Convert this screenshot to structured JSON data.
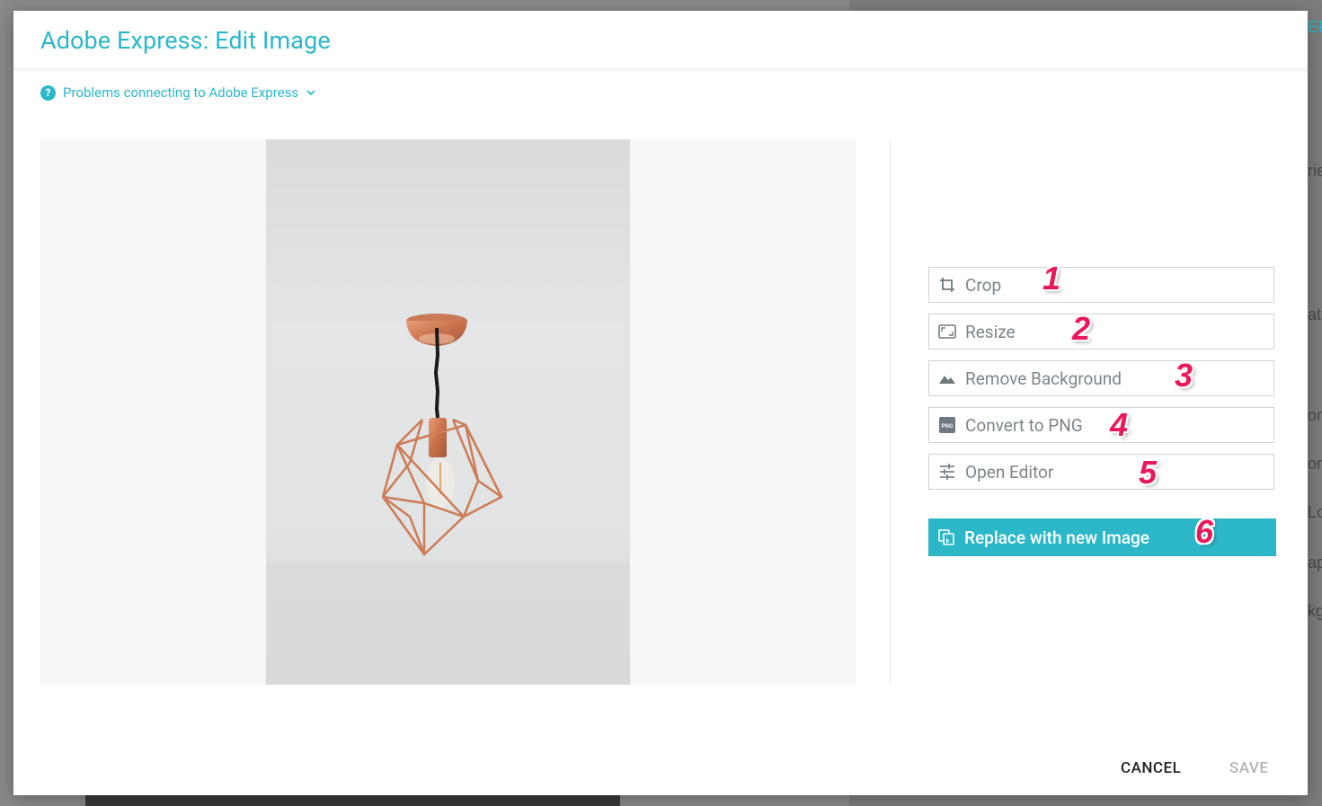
{
  "background": {
    "fragments": [
      "EF",
      "rie",
      "ate",
      "on",
      "on",
      "Lo",
      "ap",
      "kg"
    ]
  },
  "modal": {
    "title": "Adobe Express: Edit Image",
    "help_text": "Problems connecting to Adobe Express",
    "help_icon_glyph": "?"
  },
  "actions": [
    {
      "label": "Crop",
      "icon": "crop-icon",
      "badge": "1"
    },
    {
      "label": "Resize",
      "icon": "resize-icon",
      "badge": "2"
    },
    {
      "label": "Remove Background",
      "icon": "mountain-icon",
      "badge": "3"
    },
    {
      "label": "Convert to PNG",
      "icon": "png-icon",
      "badge": "4"
    },
    {
      "label": "Open Editor",
      "icon": "sliders-icon",
      "badge": "5"
    }
  ],
  "primary": {
    "label": "Replace with new Image",
    "icon": "replace-icon",
    "badge": "6"
  },
  "footer": {
    "cancel": "CANCEL",
    "save": "SAVE"
  },
  "colors": {
    "accent": "#2cb7c8",
    "badge": "#e8195a"
  }
}
